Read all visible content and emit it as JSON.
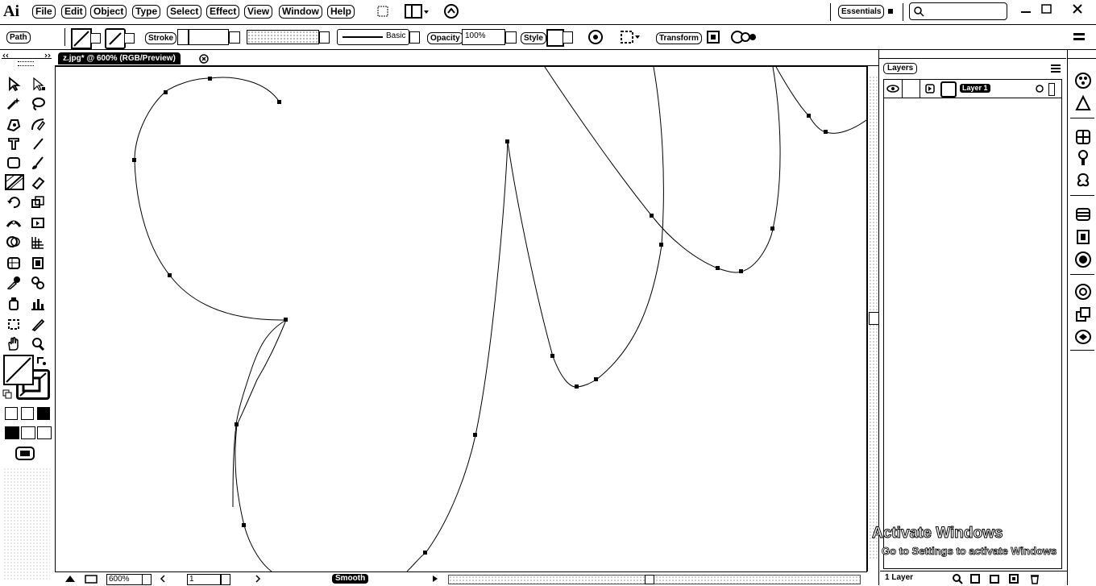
{
  "app": {
    "logo": "Ai",
    "workspace": "Essentials"
  },
  "menu": [
    "File",
    "Edit",
    "Object",
    "Type",
    "Select",
    "Effect",
    "View",
    "Window",
    "Help"
  ],
  "control": {
    "selection_type": "Path",
    "stroke_label": "Stroke",
    "brush_label": "Basic",
    "opacity_label": "Opacity",
    "opacity_value": "100%",
    "style_label": "Style",
    "transform_label": "Transform"
  },
  "document": {
    "tab_title": "z.jpg* @ 600% (RGB/Preview)"
  },
  "status": {
    "zoom": "600%",
    "artboard": "1",
    "tool_name": "Smooth"
  },
  "layers": {
    "tab_label": "Layers",
    "layer_name": "Layer 1",
    "footer_count": "1 Layer"
  },
  "watermark": {
    "title": "Activate Windows",
    "subtitle": "Go to Settings to activate Windows"
  },
  "icons": [
    "search-icon",
    "minimize-icon",
    "maximize-icon",
    "close-icon",
    "eye-icon",
    "lock-icon",
    "new-layer-icon",
    "trash-icon"
  ]
}
